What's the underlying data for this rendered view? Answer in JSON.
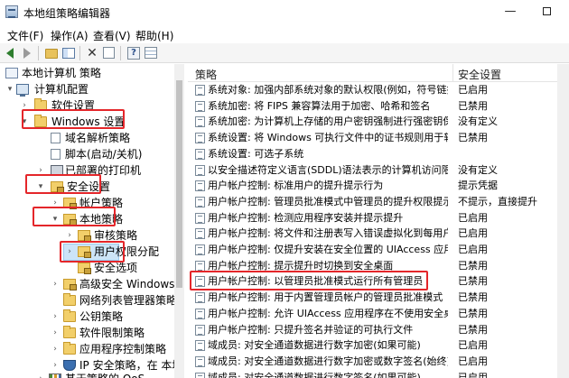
{
  "window": {
    "title": "本地组策略编辑器",
    "minimize_glyph": "—",
    "maximize_icon": "maximize-icon"
  },
  "menu": [
    "文件(F)",
    "操作(A)",
    "查看(V)",
    "帮助(H)"
  ],
  "toolbar": {
    "icons": [
      "back-arrow-icon",
      "forward-arrow-icon",
      "up-folder-icon",
      "show-hide-tree-icon",
      "delete-icon",
      "export-list-icon",
      "help-icon",
      "properties-icon"
    ]
  },
  "tree": {
    "items": [
      {
        "label": "本地计算机 策略",
        "icon": "policy-icon",
        "expanded": true
      },
      {
        "label": "计算机配置",
        "icon": "computer-icon",
        "expanded": true
      },
      {
        "label": "软件设置",
        "icon": "folder-icon",
        "expanded": false
      },
      {
        "label": "Windows 设置",
        "icon": "folder-icon",
        "expanded": true
      },
      {
        "label": "域名解析策略",
        "icon": "doc-icon",
        "expanded": false
      },
      {
        "label": "脚本(启动/关机)",
        "icon": "doc-icon",
        "expanded": false
      },
      {
        "label": "已部署的打印机",
        "icon": "printer-icon",
        "expanded": false
      },
      {
        "label": "安全设置",
        "icon": "folder-lock-icon",
        "expanded": true
      },
      {
        "label": "帐户策略",
        "icon": "folder-lock-icon",
        "expanded": false
      },
      {
        "label": "本地策略",
        "icon": "folder-lock-icon",
        "expanded": true
      },
      {
        "label": "审核策略",
        "icon": "folder-lock-icon",
        "expanded": false
      },
      {
        "label": "用户权限分配",
        "icon": "folder-lock-icon",
        "expanded": false
      },
      {
        "label": "安全选项",
        "icon": "folder-lock-icon",
        "expanded": false,
        "selected": true
      },
      {
        "label": "高级安全 Windows De",
        "icon": "folder-lock-icon",
        "expanded": false
      },
      {
        "label": "网络列表管理器策略",
        "icon": "folder-icon",
        "expanded": false
      },
      {
        "label": "公钥策略",
        "icon": "folder-icon",
        "expanded": false
      },
      {
        "label": "软件限制策略",
        "icon": "folder-icon",
        "expanded": false
      },
      {
        "label": "应用程序控制策略",
        "icon": "folder-icon",
        "expanded": false
      },
      {
        "label": "IP 安全策略，在 本地计",
        "icon": "shield-icon",
        "expanded": false
      },
      {
        "label": "基于策略的 QoS",
        "icon": "chart-icon",
        "expanded": false
      }
    ]
  },
  "list": {
    "columns": [
      "策略",
      "安全设置"
    ],
    "rows": [
      {
        "policy": "系统对象: 加强内部系统对象的默认权限(例如，符号链接)",
        "setting": "已启用"
      },
      {
        "policy": "系统加密: 将 FIPS 兼容算法用于加密、哈希和签名",
        "setting": "已禁用"
      },
      {
        "policy": "系统加密: 为计算机上存储的用户密钥强制进行强密钥保护",
        "setting": "没有定义"
      },
      {
        "policy": "系统设置: 将 Windows 可执行文件中的证书规则用于软件...",
        "setting": "已禁用"
      },
      {
        "policy": "系统设置: 可选子系统",
        "setting": ""
      },
      {
        "policy": "以安全描述符定义语言(SDDL)语法表示的计算机访问限制",
        "setting": "没有定义"
      },
      {
        "policy": "用户帐户控制: 标准用户的提升提示行为",
        "setting": "提示凭据"
      },
      {
        "policy": "用户帐户控制: 管理员批准模式中管理员的提升权限提示的...",
        "setting": "不提示，直接提升"
      },
      {
        "policy": "用户帐户控制: 检测应用程序安装并提示提升",
        "setting": "已启用"
      },
      {
        "policy": "用户帐户控制: 将文件和注册表写入错误虚拟化到每用户位置",
        "setting": "已启用"
      },
      {
        "policy": "用户帐户控制: 仅提升安装在安全位置的 UIAccess 应用程序",
        "setting": "已启用"
      },
      {
        "policy": "用户帐户控制: 提示提升时切换到安全桌面",
        "setting": "已禁用"
      },
      {
        "policy": "用户帐户控制: 以管理员批准模式运行所有管理员",
        "setting": "已禁用"
      },
      {
        "policy": "用户帐户控制: 用于内置管理员帐户的管理员批准模式",
        "setting": "已禁用"
      },
      {
        "policy": "用户帐户控制: 允许 UIAccess 应用程序在不使用安全桌面...",
        "setting": "已禁用"
      },
      {
        "policy": "用户帐户控制: 只提升签名并验证的可执行文件",
        "setting": "已禁用"
      },
      {
        "policy": "域成员: 对安全通道数据进行数字加密(如果可能)",
        "setting": "已启用"
      },
      {
        "policy": "域成员: 对安全通道数据进行数字加密或数字签名(始终)",
        "setting": "已启用"
      },
      {
        "policy": "域成员: 对安全通道数据进行数字签名(如果可能)",
        "setting": "已启用"
      }
    ]
  },
  "highlight_color": "#e4262a"
}
